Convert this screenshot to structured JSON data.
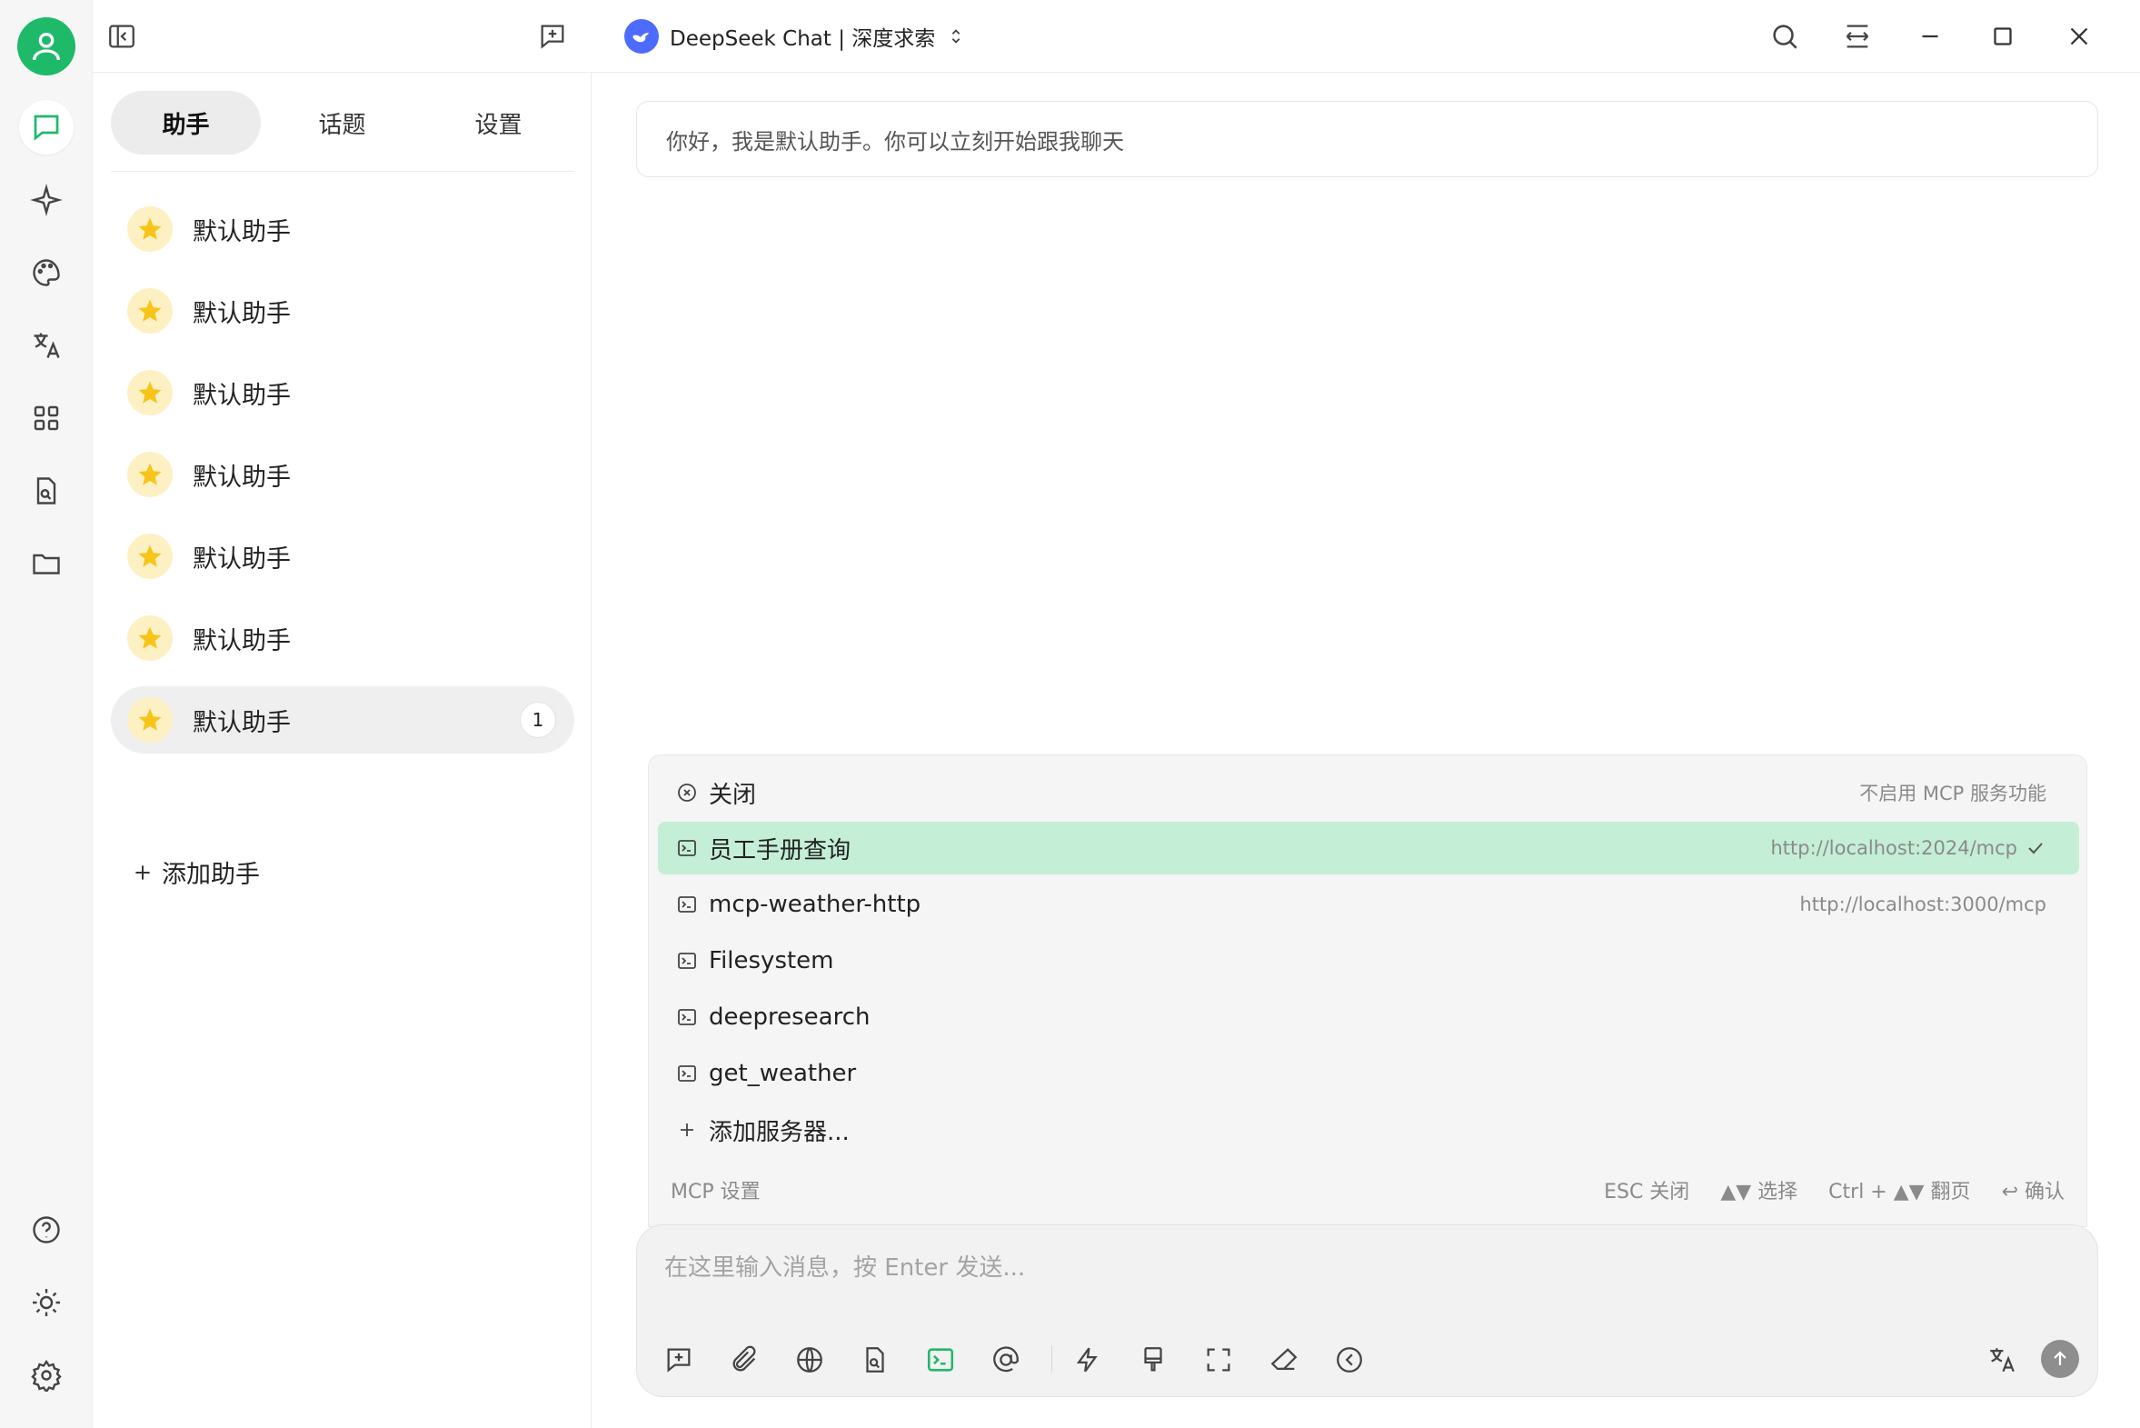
{
  "window": {
    "model": "DeepSeek Chat | 深度求索"
  },
  "sidebar_tabs": [
    "助手",
    "话题",
    "设置"
  ],
  "assistants": [
    {
      "name": "默认助手"
    },
    {
      "name": "默认助手"
    },
    {
      "name": "默认助手"
    },
    {
      "name": "默认助手"
    },
    {
      "name": "默认助手"
    },
    {
      "name": "默认助手"
    },
    {
      "name": "默认助手",
      "badge": "1"
    }
  ],
  "add_assistant": "添加助手",
  "greeting": "你好，我是默认助手。你可以立刻开始跟我聊天",
  "mcp": {
    "close_label": "关闭",
    "close_hint": "不启用 MCP 服务功能",
    "servers": [
      {
        "name": "员工手册查询",
        "url": "http://localhost:2024/mcp",
        "selected": true
      },
      {
        "name": "mcp-weather-http",
        "url": "http://localhost:3000/mcp"
      },
      {
        "name": "Filesystem",
        "url": ""
      },
      {
        "name": "deepresearch",
        "url": ""
      },
      {
        "name": "get_weather",
        "url": ""
      }
    ],
    "add_server": "添加服务器...",
    "settings": "MCP 设置",
    "hints": {
      "esc": "ESC 关闭",
      "select": "▲▼ 选择",
      "page": "Ctrl + ▲▼ 翻页",
      "confirm": "↩ 确认"
    }
  },
  "input": {
    "placeholder": "在这里输入消息，按 Enter 发送..."
  },
  "colors": {
    "accent": "#1fb96a",
    "selected_row": "#c4eed6",
    "deepseek": "#4d6bfe"
  }
}
